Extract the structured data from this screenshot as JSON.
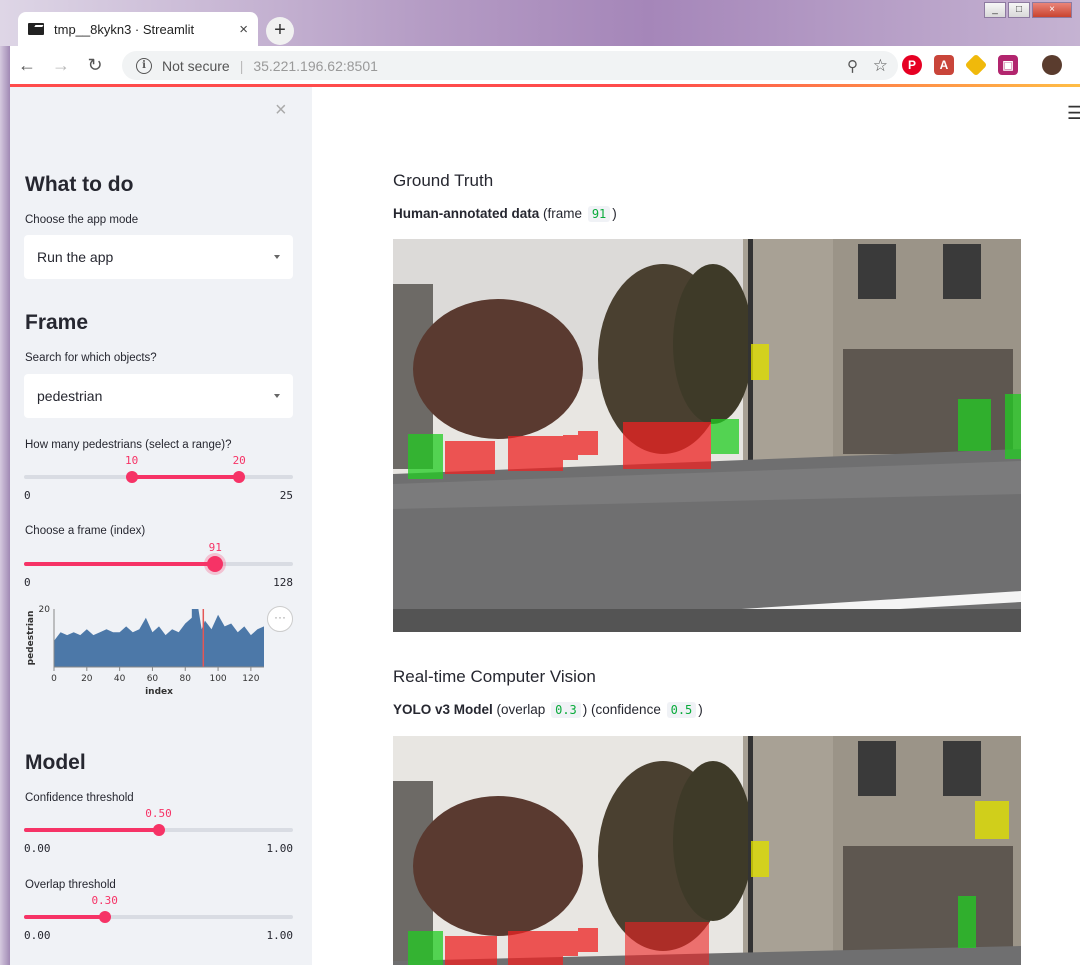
{
  "browser": {
    "tab_title": "tmp__8kykn3 · Streamlit",
    "tab_close": "×",
    "new_tab": "+",
    "security_text": "Not secure",
    "url": "35.221.196.62:8501",
    "window_buttons": [
      "_",
      "□",
      "×"
    ]
  },
  "sidebar": {
    "close": "×",
    "section1_title": "What to do",
    "mode_label": "Choose the app mode",
    "mode_value": "Run the app",
    "section2_title": "Frame",
    "objects_label": "Search for which objects?",
    "objects_value": "pedestrian",
    "range_slider": {
      "label": "How many pedestrians (select a range)?",
      "low": "10",
      "high": "20",
      "min": "0",
      "max": "25",
      "low_num": 10,
      "high_num": 20,
      "min_num": 0,
      "max_num": 25
    },
    "frame_slider": {
      "label": "Choose a frame (index)",
      "value": "91",
      "min": "0",
      "max": "128",
      "value_num": 91,
      "min_num": 0,
      "max_num": 128
    },
    "more_menu": "···",
    "section3_title": "Model",
    "confidence_slider": {
      "label": "Confidence threshold",
      "value": "0.50",
      "min": "0.00",
      "max": "1.00",
      "value_num": 0.5
    },
    "overlap_slider": {
      "label": "Overlap threshold",
      "value": "0.30",
      "min": "0.00",
      "max": "1.00",
      "value_num": 0.3
    }
  },
  "main": {
    "ground_truth_title": "Ground Truth",
    "gt_caption_bold": "Human-annotated data",
    "gt_caption_pre": "(frame",
    "gt_frame": "91",
    "gt_caption_post": ")",
    "cv_title": "Real-time Computer Vision",
    "cv_caption_bold": "YOLO v3 Model",
    "cv_overlap_pre": "(overlap",
    "cv_overlap": "0.3",
    "cv_mid": ") (confidence",
    "cv_confidence": "0.5",
    "cv_post": ")"
  },
  "chart_data": {
    "type": "area",
    "xlabel": "index",
    "ylabel": "pedestrian",
    "xlim": [
      0,
      128
    ],
    "ylim": [
      0,
      20
    ],
    "xticks": [
      "0",
      "20",
      "40",
      "60",
      "80",
      "100",
      "120"
    ],
    "yticks": [
      "20"
    ],
    "x": [
      0,
      4,
      8,
      12,
      16,
      20,
      24,
      28,
      32,
      36,
      40,
      44,
      48,
      52,
      56,
      60,
      64,
      68,
      72,
      76,
      80,
      84,
      88,
      90,
      92,
      96,
      100,
      104,
      108,
      112,
      116,
      120,
      124,
      128
    ],
    "values": [
      9,
      12,
      11,
      12,
      11,
      13,
      11,
      12,
      13,
      12,
      12,
      14,
      12,
      13,
      17,
      12,
      14,
      11,
      13,
      12,
      15,
      17,
      20,
      13,
      16,
      13,
      18,
      14,
      15,
      12,
      14,
      11,
      13,
      14
    ],
    "marker_x": 91,
    "highlight_x": [
      84,
      88
    ],
    "colors": {
      "area": "#4c78a8",
      "marker": "#e45756"
    }
  }
}
